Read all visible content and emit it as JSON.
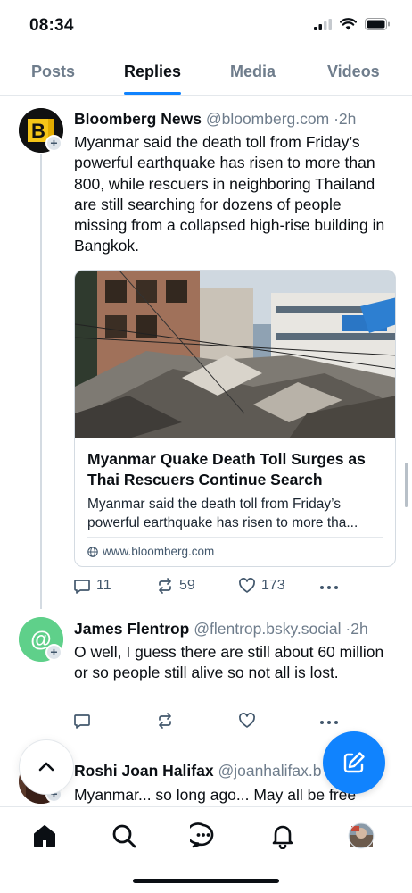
{
  "status_bar": {
    "time": "08:34"
  },
  "tabs": [
    {
      "label": "Posts",
      "active": false
    },
    {
      "label": "Replies",
      "active": true
    },
    {
      "label": "Media",
      "active": false
    },
    {
      "label": "Videos",
      "active": false
    }
  ],
  "posts": [
    {
      "avatar_letter": "B",
      "name": "Bloomberg News",
      "handle": "@bloomberg.com",
      "time": "2h",
      "text": "Myanmar said the death toll from Friday’s powerful earthquake has risen to more than 800, while rescuers in neighboring Thailand are still searching for dozens of people missing from a collapsed high-rise building in Bangkok.",
      "card": {
        "title": "Myanmar Quake Death Toll Surges as Thai Rescuers Continue Search",
        "description": "Myanmar said the death toll from Friday’s powerful earthquake has risen to more tha...",
        "domain": "www.bloomberg.com"
      },
      "replies": "11",
      "reposts": "59",
      "likes": "173"
    },
    {
      "avatar_letter": "@",
      "name": "James Flentrop",
      "handle": "@flentrop.bsky.social",
      "time": "2h",
      "text": "O well, I guess there are still about 60 million or so people still alive so not all is lost.",
      "replies": "",
      "reposts": "",
      "likes": ""
    },
    {
      "name": "Roshi Joan Halifax",
      "handle": "@joanhalifax.b",
      "time": "h",
      "text": "Myanmar... so long ago... May all be free"
    }
  ],
  "colors": {
    "accent": "#1083fe",
    "muted": "#6f7d8c",
    "bloomberg_yellow": "#f5c518"
  },
  "icons": {
    "nav": [
      "home-icon",
      "search-icon",
      "chat-icon",
      "bell-icon",
      "profile-avatar"
    ],
    "compose": "compose-icon",
    "scroll_top": "chevron-up-icon"
  }
}
